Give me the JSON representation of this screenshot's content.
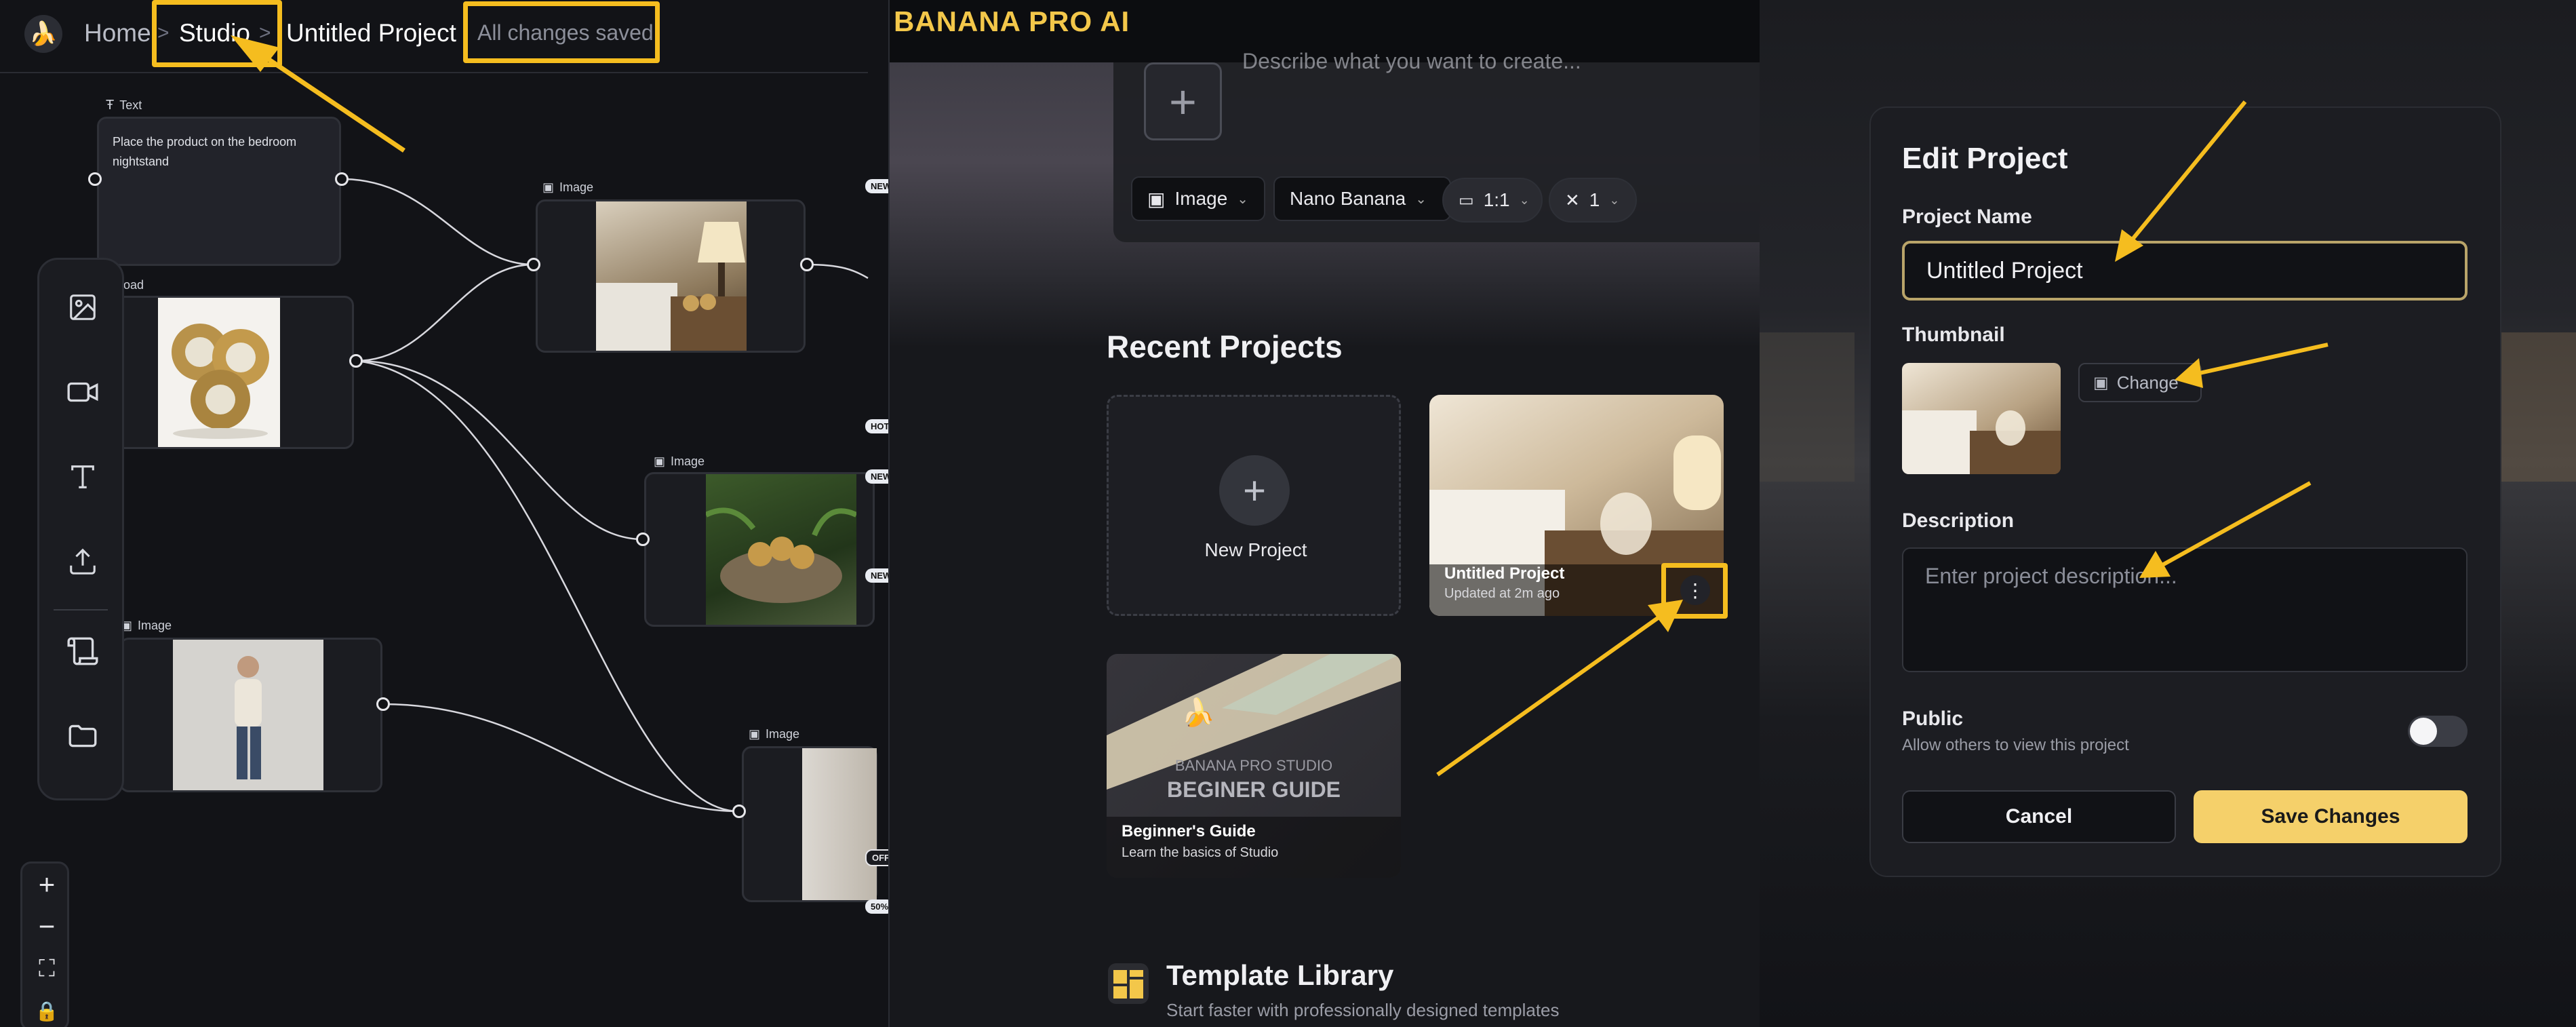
{
  "colors": {
    "accent": "#f5bd1f",
    "canvas_bg": "#121317",
    "node_bg": "#1b1c21",
    "brand_yellow": "#f3c74a",
    "save_button": "#f5d06a"
  },
  "studio": {
    "breadcrumb": {
      "home": "Home",
      "studio": "Studio",
      "project": "Untitled Project",
      "separator": ">"
    },
    "status": "All changes saved",
    "nodes": {
      "text_label": "Text",
      "text_content": "Place the product on the bedroom nightstand",
      "upload_label": "pload",
      "image_label": "Image"
    },
    "tags": [
      "NEW",
      "HOT",
      "NEW",
      "NEW",
      "OFF",
      "50%"
    ],
    "tools": [
      "image-tool-icon",
      "video-tool-icon",
      "text-tool-icon",
      "upload-tool-icon",
      "script-tool-icon",
      "folder-icon"
    ],
    "zoom": {
      "in": "+",
      "out": "−",
      "fit": "⛶",
      "lock": "🔒"
    }
  },
  "banana": {
    "brand": "BANANA PRO AI",
    "prompt_placeholder": "Describe what you want to create...",
    "chips": {
      "type": "Image",
      "model": "Nano Banana",
      "ratio": "1:1",
      "count": "1"
    },
    "recent_title": "Recent Projects",
    "new_project": "New Project",
    "projects": [
      {
        "title": "Untitled Project",
        "subtitle": "Updated at 2m ago"
      },
      {
        "title": "Beginner's Guide",
        "subtitle": "Learn the basics of Studio",
        "banner_line1": "BANANA PRO STUDIO",
        "banner_line2": "BEGINER GUIDE"
      }
    ],
    "template": {
      "title": "Template Library",
      "subtitle": "Start faster with professionally designed templates"
    }
  },
  "edit_modal": {
    "title": "Edit Project",
    "project_name_label": "Project Name",
    "project_name_value": "Untitled Project",
    "thumbnail_label": "Thumbnail",
    "change_button": "Change",
    "description_label": "Description",
    "description_placeholder": "Enter project description...",
    "public_label": "Public",
    "public_hint": "Allow others to view this project",
    "public_enabled": false,
    "cancel_button": "Cancel",
    "save_button": "Save Changes"
  }
}
